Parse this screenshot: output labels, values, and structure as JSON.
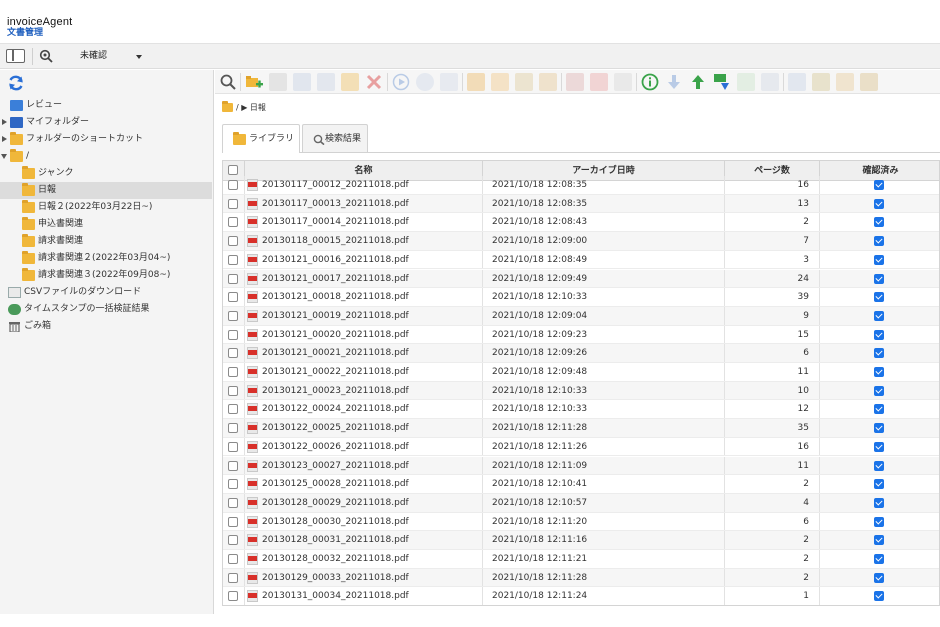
{
  "brand": {
    "name": "invoiceAgent",
    "sub": "文書管理"
  },
  "topbar": {
    "filter_value": "未確認"
  },
  "sidebar": {
    "items": [
      {
        "label": "レビュー"
      },
      {
        "label": "マイフォルダー"
      },
      {
        "label": "フォルダーのショートカット"
      },
      {
        "label": "/"
      },
      {
        "label": "ジャンク"
      },
      {
        "label": "日報"
      },
      {
        "label": "日報２(2022年03月22日~)"
      },
      {
        "label": "申込書関連"
      },
      {
        "label": "請求書関連"
      },
      {
        "label": "請求書関連２(2022年03月04~)"
      },
      {
        "label": "請求書関連３(2022年09月08~)"
      },
      {
        "label": "CSVファイルのダウンロード"
      },
      {
        "label": "タイムスタンプの一括検証結果"
      },
      {
        "label": "ごみ箱"
      }
    ]
  },
  "breadcrumb": {
    "text": "/ ▶ 日報"
  },
  "tabs": [
    {
      "label": "ライブラリ"
    },
    {
      "label": "検索結果"
    }
  ],
  "grid": {
    "columns": {
      "name": "名称",
      "archive_date": "アーカイブ日時",
      "pages": "ページ数",
      "confirmed": "確認済み"
    },
    "rows": [
      {
        "name": "20130117_00012_20211018.pdf",
        "date": "2021/10/18 12:08:35",
        "pages": "16"
      },
      {
        "name": "20130117_00013_20211018.pdf",
        "date": "2021/10/18 12:08:35",
        "pages": "13"
      },
      {
        "name": "20130117_00014_20211018.pdf",
        "date": "2021/10/18 12:08:43",
        "pages": "2"
      },
      {
        "name": "20130118_00015_20211018.pdf",
        "date": "2021/10/18 12:09:00",
        "pages": "7"
      },
      {
        "name": "20130121_00016_20211018.pdf",
        "date": "2021/10/18 12:08:49",
        "pages": "3"
      },
      {
        "name": "20130121_00017_20211018.pdf",
        "date": "2021/10/18 12:09:49",
        "pages": "24"
      },
      {
        "name": "20130121_00018_20211018.pdf",
        "date": "2021/10/18 12:10:33",
        "pages": "39"
      },
      {
        "name": "20130121_00019_20211018.pdf",
        "date": "2021/10/18 12:09:04",
        "pages": "9"
      },
      {
        "name": "20130121_00020_20211018.pdf",
        "date": "2021/10/18 12:09:23",
        "pages": "15"
      },
      {
        "name": "20130121_00021_20211018.pdf",
        "date": "2021/10/18 12:09:26",
        "pages": "6"
      },
      {
        "name": "20130121_00022_20211018.pdf",
        "date": "2021/10/18 12:09:48",
        "pages": "11"
      },
      {
        "name": "20130121_00023_20211018.pdf",
        "date": "2021/10/18 12:10:33",
        "pages": "10"
      },
      {
        "name": "20130122_00024_20211018.pdf",
        "date": "2021/10/18 12:10:33",
        "pages": "12"
      },
      {
        "name": "20130122_00025_20211018.pdf",
        "date": "2021/10/18 12:11:28",
        "pages": "35"
      },
      {
        "name": "20130122_00026_20211018.pdf",
        "date": "2021/10/18 12:11:26",
        "pages": "16"
      },
      {
        "name": "20130123_00027_20211018.pdf",
        "date": "2021/10/18 12:11:09",
        "pages": "11"
      },
      {
        "name": "20130125_00028_20211018.pdf",
        "date": "2021/10/18 12:10:41",
        "pages": "2"
      },
      {
        "name": "20130128_00029_20211018.pdf",
        "date": "2021/10/18 12:10:57",
        "pages": "4"
      },
      {
        "name": "20130128_00030_20211018.pdf",
        "date": "2021/10/18 12:11:20",
        "pages": "6"
      },
      {
        "name": "20130128_00031_20211018.pdf",
        "date": "2021/10/18 12:11:16",
        "pages": "2"
      },
      {
        "name": "20130128_00032_20211018.pdf",
        "date": "2021/10/18 12:11:21",
        "pages": "2"
      },
      {
        "name": "20130129_00033_20211018.pdf",
        "date": "2021/10/18 12:11:28",
        "pages": "2"
      },
      {
        "name": "20130131_00034_20211018.pdf",
        "date": "2021/10/18 12:11:24",
        "pages": "1"
      }
    ]
  }
}
